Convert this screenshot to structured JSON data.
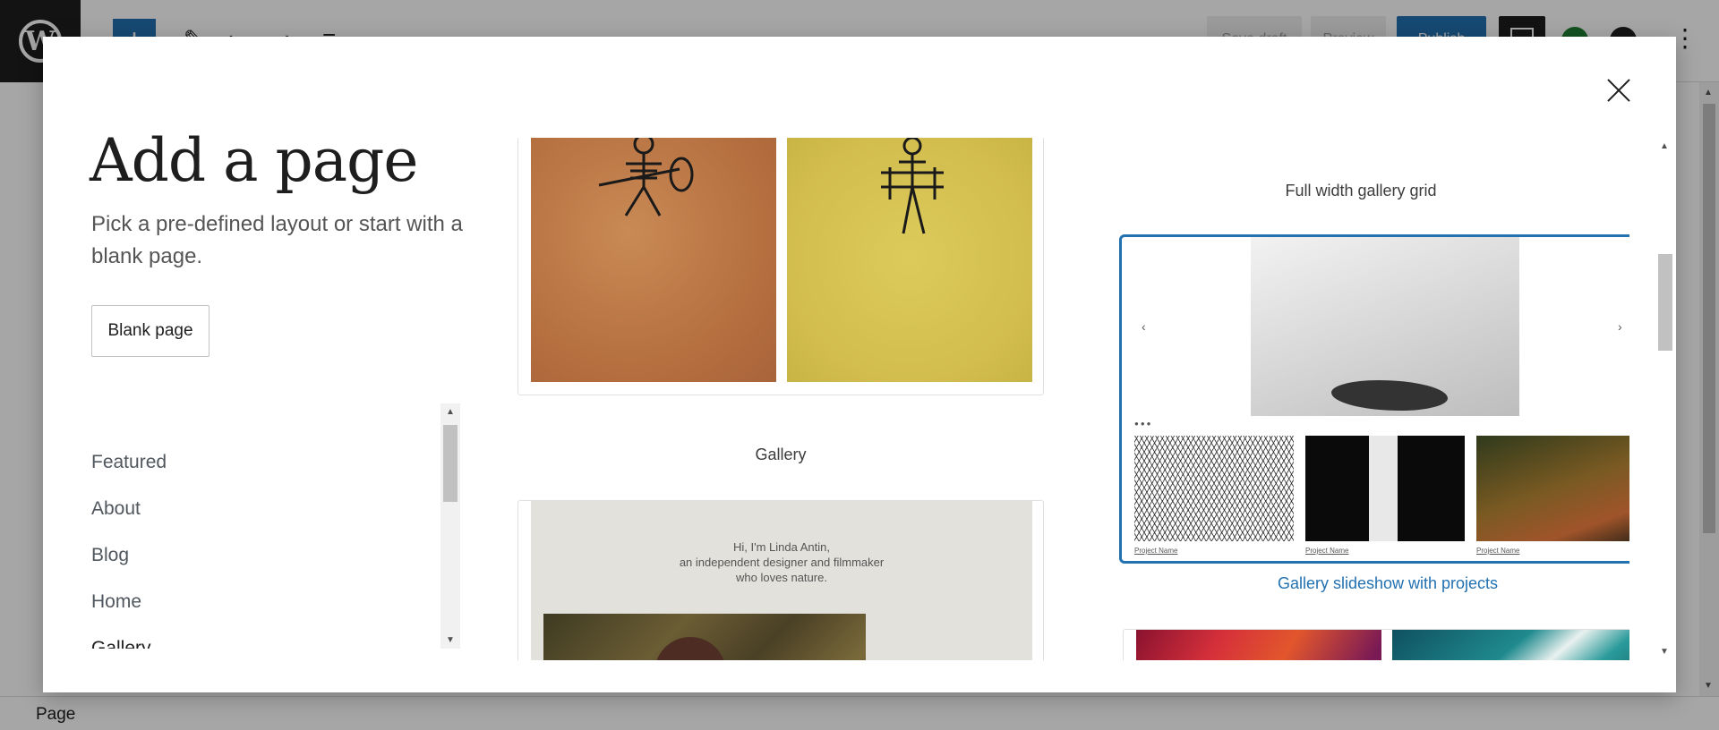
{
  "background": {
    "status_label": "Page",
    "toolbar": {
      "save_draft_label": "Save draft",
      "preview_label": "Preview",
      "publish_label": "Publish",
      "accent_color": "#2271b1"
    }
  },
  "modal": {
    "title": "Add a page",
    "subtitle": "Pick a pre-defined layout or start with a blank page.",
    "blank_page_label": "Blank page",
    "close_icon": "close-icon",
    "categories": [
      {
        "label": "Featured",
        "active": false
      },
      {
        "label": "About",
        "active": false
      },
      {
        "label": "Blog",
        "active": false
      },
      {
        "label": "Home",
        "active": false
      },
      {
        "label": "Gallery",
        "active": true
      }
    ],
    "patterns": {
      "gallery": {
        "label": "Gallery"
      },
      "full_width_grid": {
        "label": "Full width gallery grid"
      },
      "linda": {
        "intro_lines": [
          "Hi, I'm Linda Antin,",
          "an independent designer and filmmaker",
          "who loves nature."
        ]
      },
      "slideshow": {
        "label": "Gallery slideshow with projects",
        "prev_arrow": "‹",
        "next_arrow": "›",
        "project_names": [
          "Project Name",
          "Project Name",
          "Project Name"
        ]
      }
    }
  }
}
